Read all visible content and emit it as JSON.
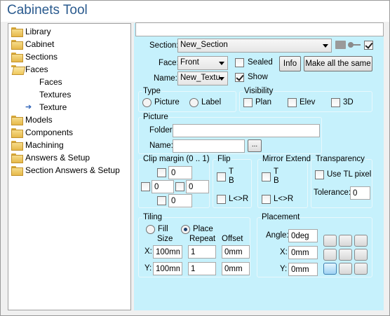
{
  "app": {
    "title": "Cabinets Tool"
  },
  "tree": {
    "items": [
      {
        "label": "Library",
        "icon": "folder-icon",
        "indent": 0
      },
      {
        "label": "Cabinet",
        "icon": "folder-icon",
        "indent": 0
      },
      {
        "label": "Sections",
        "icon": "folder-icon",
        "indent": 0
      },
      {
        "label": "Faces",
        "icon": "open-folder-icon",
        "indent": 0
      },
      {
        "label": "Faces",
        "icon": "none",
        "indent": 1
      },
      {
        "label": "Textures",
        "icon": "none",
        "indent": 1
      },
      {
        "label": "Texture",
        "icon": "arrow-right-icon",
        "indent": 1
      },
      {
        "label": "Models",
        "icon": "folder-icon",
        "indent": 0
      },
      {
        "label": "Components",
        "icon": "folder-icon",
        "indent": 0
      },
      {
        "label": "Machining",
        "icon": "folder-icon",
        "indent": 0
      },
      {
        "label": "Answers & Setup",
        "icon": "folder-icon",
        "indent": 0
      },
      {
        "label": "Section Answers & Setup",
        "icon": "folder-icon",
        "indent": 0
      }
    ]
  },
  "top_input": {
    "value": ""
  },
  "section": {
    "label": "Section:",
    "value": "New_Section",
    "checked": true
  },
  "face": {
    "label": "Face:",
    "value": "Front"
  },
  "name": {
    "label": "Name:",
    "value": "New_Textu"
  },
  "sealed": {
    "label": "Sealed",
    "checked": false
  },
  "show": {
    "label": "Show",
    "checked": true
  },
  "buttons": {
    "info": "Info",
    "make_same": "Make all the same",
    "browse": "..."
  },
  "type": {
    "title": "Type",
    "picture": "Picture",
    "label": "Label"
  },
  "visibility": {
    "title": "Visibility",
    "plan": "Plan",
    "elev": "Elev",
    "three_d": "3D"
  },
  "picture": {
    "title": "Picture",
    "folder_label": "Folder:",
    "folder_value": "",
    "name_label": "Name:",
    "name_value": ""
  },
  "clip": {
    "title": "Clip margin (0 .. 1)",
    "top": "0",
    "left": "0",
    "right": "0",
    "bottom": "0"
  },
  "flip": {
    "title": "Flip",
    "tb": "T\nB",
    "t": "T",
    "b": "B",
    "lr": "L<>R"
  },
  "mirror": {
    "title": "Mirror Extend",
    "t": "T",
    "b": "B",
    "lr": "L<>R"
  },
  "transparency": {
    "title": "Transparency",
    "use_tl": "Use TL pixel",
    "tolerance_label": "Tolerance:",
    "tolerance_value": "0"
  },
  "tiling": {
    "title": "Tiling",
    "fill": "Fill",
    "place": "Place",
    "size": "Size",
    "repeat": "Repeat",
    "offset": "Offset",
    "x_label": "X:",
    "y_label": "Y:",
    "x_size": "100mm",
    "x_repeat": "1",
    "x_offset": "0mm",
    "y_size": "100mm",
    "y_repeat": "1",
    "y_offset": "0mm"
  },
  "placement": {
    "title": "Placement",
    "angle_label": "Angle:",
    "angle_value": "0deg",
    "x_label": "X:",
    "x_value": "0mm",
    "y_label": "Y:",
    "y_value": "0mm"
  }
}
